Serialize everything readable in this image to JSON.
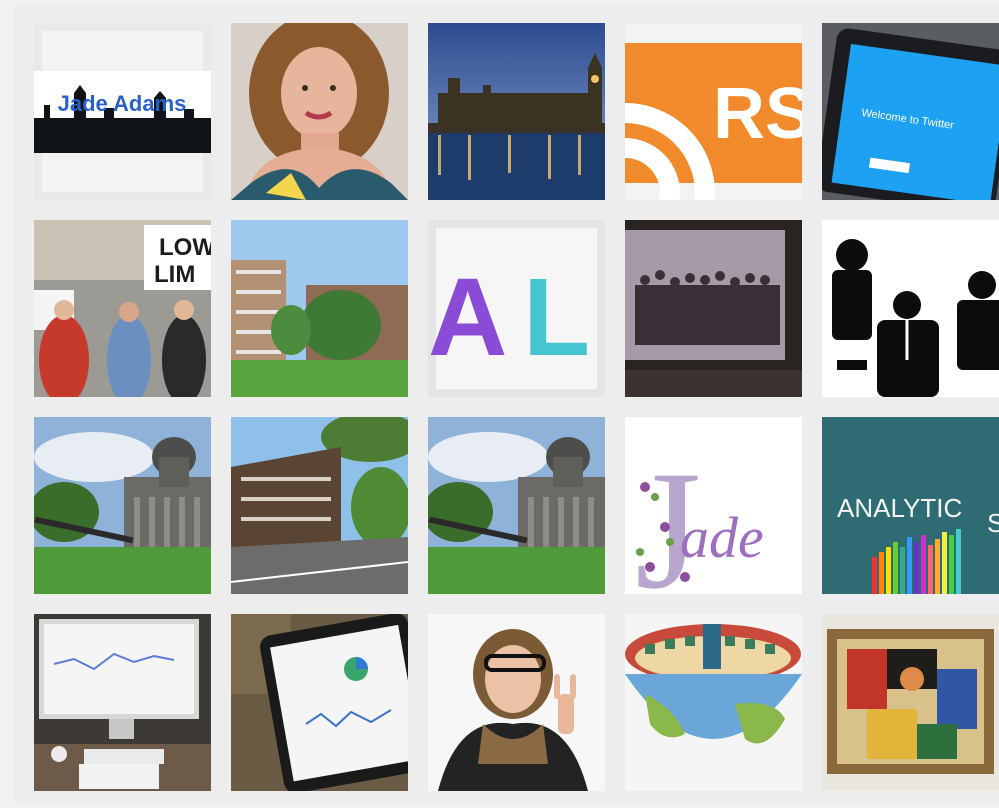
{
  "gallery": {
    "tiles": [
      {
        "name": "jade-adams-logo",
        "text": "Jade Adams"
      },
      {
        "name": "portrait-woman-smiling"
      },
      {
        "name": "london-parliament-dusk"
      },
      {
        "name": "rss-logo",
        "text": "RS"
      },
      {
        "name": "twitter-tablet",
        "text": "Welcome to Twitter"
      },
      {
        "name": "protest-placards",
        "text": "LOW",
        "text2": "LIM"
      },
      {
        "name": "housing-estate-park"
      },
      {
        "name": "al-brush-letters",
        "text": "AL"
      },
      {
        "name": "projected-crowd-photo"
      },
      {
        "name": "business-silhouettes"
      },
      {
        "name": "imperial-war-museum"
      },
      {
        "name": "apartment-block-street"
      },
      {
        "name": "imperial-war-museum-2"
      },
      {
        "name": "jade-floral-logo",
        "text": "ade",
        "initial": "J"
      },
      {
        "name": "analytics-chalkboard",
        "text": "ANALYTIC",
        "text2": "S"
      },
      {
        "name": "desktop-analytics"
      },
      {
        "name": "tablet-analytics"
      },
      {
        "name": "woman-peace-sign"
      },
      {
        "name": "world-bowl-illustration"
      },
      {
        "name": "framed-cubist-painting"
      }
    ]
  },
  "colors": {
    "frame": "#ededed",
    "rss_orange": "#f08a2b",
    "twitter_blue": "#1da1f2",
    "purple": "#8a4bd6",
    "teal": "#45c5cf"
  }
}
